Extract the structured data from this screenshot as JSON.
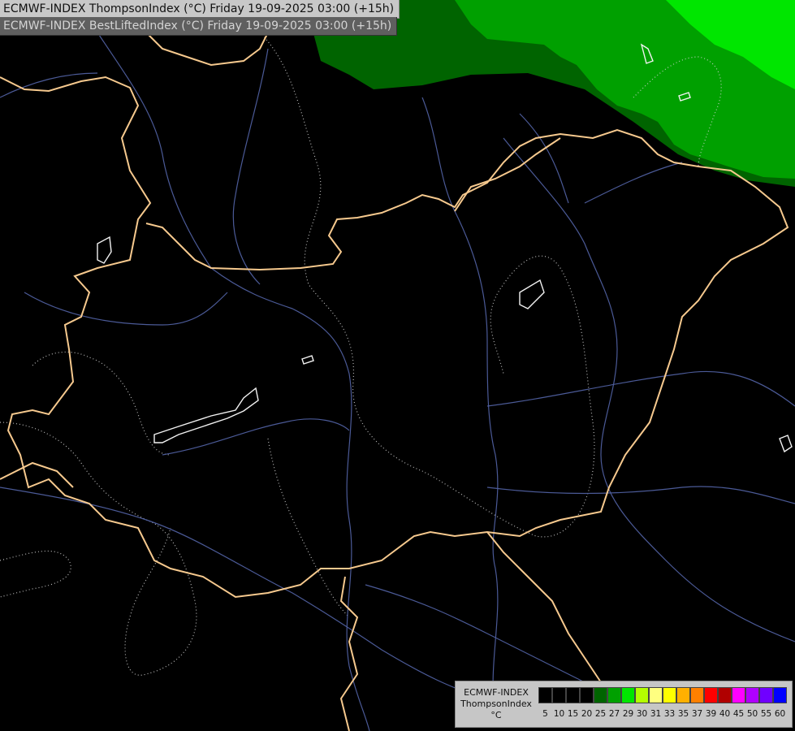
{
  "header": {
    "line1": "ECMWF-INDEX ThompsonIndex (°C) Friday 19-09-2025 03:00 (+15h)",
    "line2": "ECMWF-INDEX BestLiftedIndex (°C) Friday 19-09-2025 03:00 (+15h)"
  },
  "legend": {
    "title_line1": "ECMWF-INDEX",
    "title_line2": "ThompsonIndex",
    "unit": "°C",
    "ticks": [
      "5",
      "10",
      "15",
      "20",
      "25",
      "27",
      "29",
      "30",
      "31",
      "33",
      "35",
      "37",
      "39",
      "40",
      "45",
      "50",
      "55",
      "60"
    ],
    "colors": [
      "#000000",
      "#000000",
      "#000000",
      "#000000",
      "#006400",
      "#00a000",
      "#00e600",
      "#b4ff00",
      "#ffff80",
      "#ffff00",
      "#ffb000",
      "#ff8000",
      "#ff0000",
      "#b00000",
      "#ff00ff",
      "#b000ff",
      "#7000ff",
      "#0000ff"
    ]
  }
}
